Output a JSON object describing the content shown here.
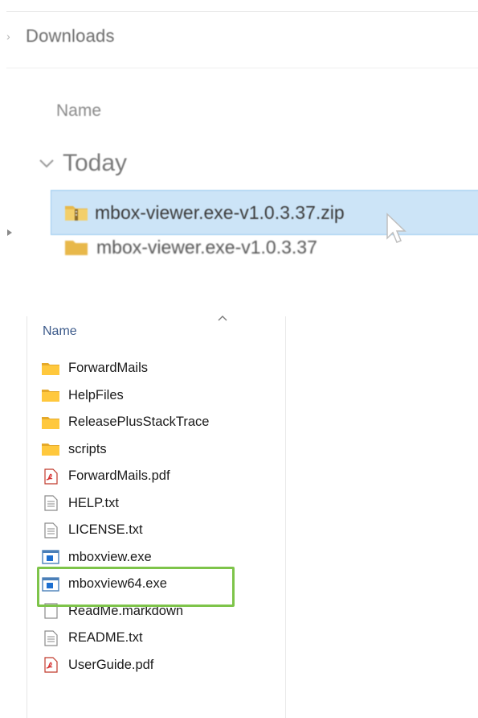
{
  "top": {
    "breadcrumb": "Downloads",
    "column_header": "Name",
    "group_label": "Today",
    "selected_file": "mbox-viewer.exe-v1.0.3.37.zip",
    "next_row_partial": "mbox-viewer.exe-v1.0.3.37"
  },
  "list": {
    "column_header": "Name",
    "items": [
      {
        "name": "ForwardMails",
        "icon": "folder-icon"
      },
      {
        "name": "HelpFiles",
        "icon": "folder-icon"
      },
      {
        "name": "ReleasePlusStackTrace",
        "icon": "folder-icon"
      },
      {
        "name": "scripts",
        "icon": "folder-icon"
      },
      {
        "name": "ForwardMails.pdf",
        "icon": "pdf-icon"
      },
      {
        "name": "HELP.txt",
        "icon": "text-file-icon"
      },
      {
        "name": "LICENSE.txt",
        "icon": "text-file-icon"
      },
      {
        "name": "mboxview.exe",
        "icon": "exe-icon"
      },
      {
        "name": "mboxview64.exe",
        "icon": "exe-icon"
      },
      {
        "name": "ReadMe.markdown",
        "icon": "blank-file-icon"
      },
      {
        "name": "README.txt",
        "icon": "text-file-icon"
      },
      {
        "name": "UserGuide.pdf",
        "icon": "pdf-icon"
      }
    ],
    "highlighted_item": "mboxview64.exe"
  },
  "colors": {
    "selection": "#cce4f7",
    "highlight": "#7ec44a",
    "folder": "#ffc83d",
    "header_text": "#3c5a8a"
  }
}
